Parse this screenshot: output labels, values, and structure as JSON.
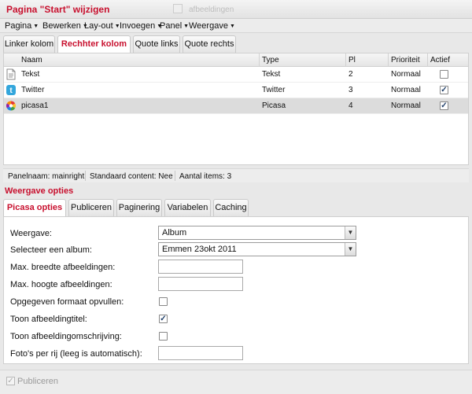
{
  "window": {
    "title": "Pagina \"Start\" wijzigen",
    "ghost_text": "afbeeldingen"
  },
  "menu": [
    "Pagina",
    "Bewerken",
    "Lay-out",
    "Invoegen",
    "Panel",
    "Weergave"
  ],
  "top_tabs": [
    "Linker kolom",
    "Rechhter kolom",
    "Quote links",
    "Quote rechts"
  ],
  "grid": {
    "columns": [
      "Naam",
      "Type",
      "Pl",
      "Prioriteit",
      "Actief"
    ],
    "rows": [
      {
        "icon": "text-document-icon",
        "name": "Tekst",
        "type": "Tekst",
        "pl": "2",
        "priority": "Normaal",
        "active": false
      },
      {
        "icon": "twitter-icon",
        "name": "Twitter",
        "type": "Twitter",
        "pl": "3",
        "priority": "Normaal",
        "active": true
      },
      {
        "icon": "picasa-icon",
        "name": "picasa1",
        "type": "Picasa",
        "pl": "4",
        "priority": "Normaal",
        "active": true
      }
    ]
  },
  "status": {
    "panel_name": "Panelnaam: mainright",
    "standard_content": "Standaard content: Nee",
    "items": "Aantal items: 3"
  },
  "section_title": "Weergave opties",
  "option_tabs": [
    "Picasa opties",
    "Publiceren",
    "Paginering",
    "Variabelen",
    "Caching"
  ],
  "form": {
    "weergave_label": "Weergave:",
    "weergave_value": "Album",
    "album_label": "Selecteer een album:",
    "album_value": "Emmen 23okt 2011",
    "max_width_label": "Max. breedte afbeeldingen:",
    "max_width_value": "",
    "max_height_label": "Max. hoogte afbeeldingen:",
    "max_height_value": "",
    "fill_label": "Opgegeven formaat opvullen:",
    "fill_checked": false,
    "show_title_label": "Toon afbeeldingtitel:",
    "show_title_checked": true,
    "show_desc_label": "Toon afbeeldingomschrijving:",
    "show_desc_checked": false,
    "per_row_label": "Foto's per rij (leeg is automatisch):",
    "per_row_value": ""
  },
  "footer": {
    "publish_label": "Publiceren",
    "publish_checked": true
  },
  "colors": {
    "accent": "#c8102e",
    "selected_row": "#dcdcdc"
  }
}
